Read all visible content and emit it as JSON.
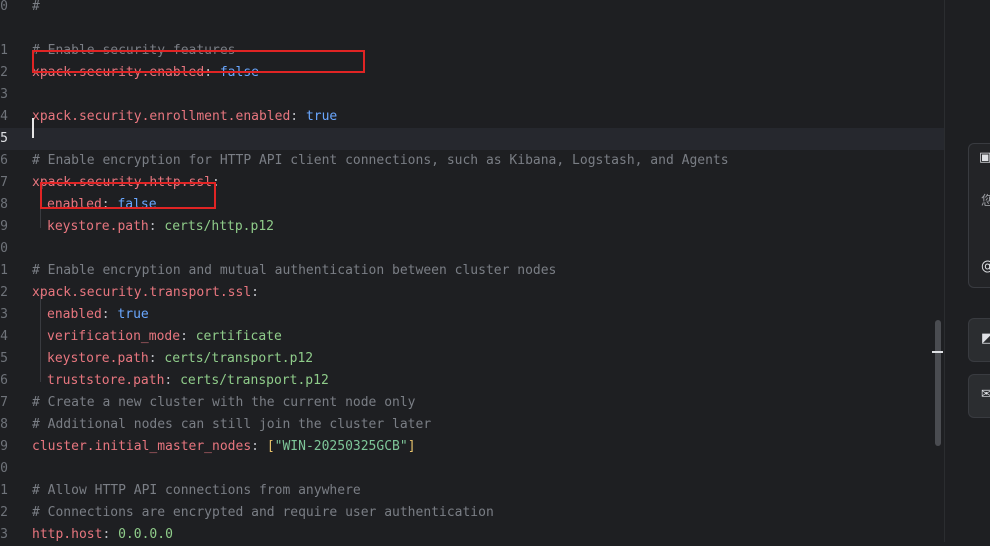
{
  "editor": {
    "lines": [
      {
        "n": "0",
        "parts": [
          {
            "c": "com",
            "t": "#"
          }
        ]
      },
      {
        "n": "",
        "parts": []
      },
      {
        "n": "1",
        "parts": [
          {
            "c": "com",
            "t": "# Enable security features"
          }
        ]
      },
      {
        "n": "2",
        "parts": [
          {
            "c": "key",
            "t": "xpack.security.enabled"
          },
          {
            "c": "punc",
            "t": ": "
          },
          {
            "c": "bool",
            "t": "false"
          }
        ]
      },
      {
        "n": "3",
        "parts": []
      },
      {
        "n": "4",
        "parts": [
          {
            "c": "key",
            "t": "xpack.security.enrollment.enabled"
          },
          {
            "c": "punc",
            "t": ": "
          },
          {
            "c": "bool",
            "t": "true"
          }
        ]
      },
      {
        "n": "5",
        "parts": [],
        "active": true
      },
      {
        "n": "6",
        "parts": [
          {
            "c": "com",
            "t": "# Enable encryption for HTTP API client connections, such as Kibana, Logstash, and Agents"
          }
        ]
      },
      {
        "n": "7",
        "parts": [
          {
            "c": "key",
            "t": "xpack.security.http.ssl"
          },
          {
            "c": "punc",
            "t": ":"
          }
        ]
      },
      {
        "n": "8",
        "indent": true,
        "parts": [
          {
            "c": "key",
            "t": "enabled"
          },
          {
            "c": "punc",
            "t": ": "
          },
          {
            "c": "bool",
            "t": "false"
          }
        ]
      },
      {
        "n": "9",
        "indent": true,
        "parts": [
          {
            "c": "key",
            "t": "keystore.path"
          },
          {
            "c": "punc",
            "t": ": "
          },
          {
            "c": "val",
            "t": "certs/http.p12"
          }
        ]
      },
      {
        "n": "0",
        "parts": []
      },
      {
        "n": "1",
        "parts": [
          {
            "c": "com",
            "t": "# Enable encryption and mutual authentication between cluster nodes"
          }
        ]
      },
      {
        "n": "2",
        "parts": [
          {
            "c": "key",
            "t": "xpack.security.transport.ssl"
          },
          {
            "c": "punc",
            "t": ":"
          }
        ]
      },
      {
        "n": "3",
        "indent": true,
        "parts": [
          {
            "c": "key",
            "t": "enabled"
          },
          {
            "c": "punc",
            "t": ": "
          },
          {
            "c": "bool",
            "t": "true"
          }
        ]
      },
      {
        "n": "4",
        "indent": true,
        "parts": [
          {
            "c": "key",
            "t": "verification_mode"
          },
          {
            "c": "punc",
            "t": ": "
          },
          {
            "c": "val",
            "t": "certificate"
          }
        ]
      },
      {
        "n": "5",
        "indent": true,
        "parts": [
          {
            "c": "key",
            "t": "keystore.path"
          },
          {
            "c": "punc",
            "t": ": "
          },
          {
            "c": "val",
            "t": "certs/transport.p12"
          }
        ]
      },
      {
        "n": "6",
        "indent": true,
        "parts": [
          {
            "c": "key",
            "t": "truststore.path"
          },
          {
            "c": "punc",
            "t": ": "
          },
          {
            "c": "val",
            "t": "certs/transport.p12"
          }
        ]
      },
      {
        "n": "7",
        "parts": [
          {
            "c": "com",
            "t": "# Create a new cluster with the current node only"
          }
        ]
      },
      {
        "n": "8",
        "parts": [
          {
            "c": "com",
            "t": "# Additional nodes can still join the cluster later"
          }
        ]
      },
      {
        "n": "9",
        "parts": [
          {
            "c": "key",
            "t": "cluster.initial_master_nodes"
          },
          {
            "c": "punc",
            "t": ": "
          },
          {
            "c": "br",
            "t": "["
          },
          {
            "c": "str",
            "t": "\"WIN-20250325GCB\""
          },
          {
            "c": "br",
            "t": "]"
          }
        ]
      },
      {
        "n": "0",
        "parts": []
      },
      {
        "n": "1",
        "parts": [
          {
            "c": "com",
            "t": "# Allow HTTP API connections from anywhere"
          }
        ]
      },
      {
        "n": "2",
        "parts": [
          {
            "c": "com",
            "t": "# Connections are encrypted and require user authentication"
          }
        ]
      },
      {
        "n": "3",
        "parts": [
          {
            "c": "key",
            "t": "http.host"
          },
          {
            "c": "punc",
            "t": ": "
          },
          {
            "c": "val",
            "t": "0.0.0.0"
          }
        ]
      }
    ]
  },
  "side_panel": {
    "input_hint": "您",
    "at_icon": "at-sign-icon",
    "header_icon": "assistant-icon"
  },
  "colors": {
    "highlight_box": "#e02424",
    "key": "#e8767f",
    "bool": "#6aa7ff",
    "value": "#8fcc8a",
    "comment": "#7a7e85"
  }
}
